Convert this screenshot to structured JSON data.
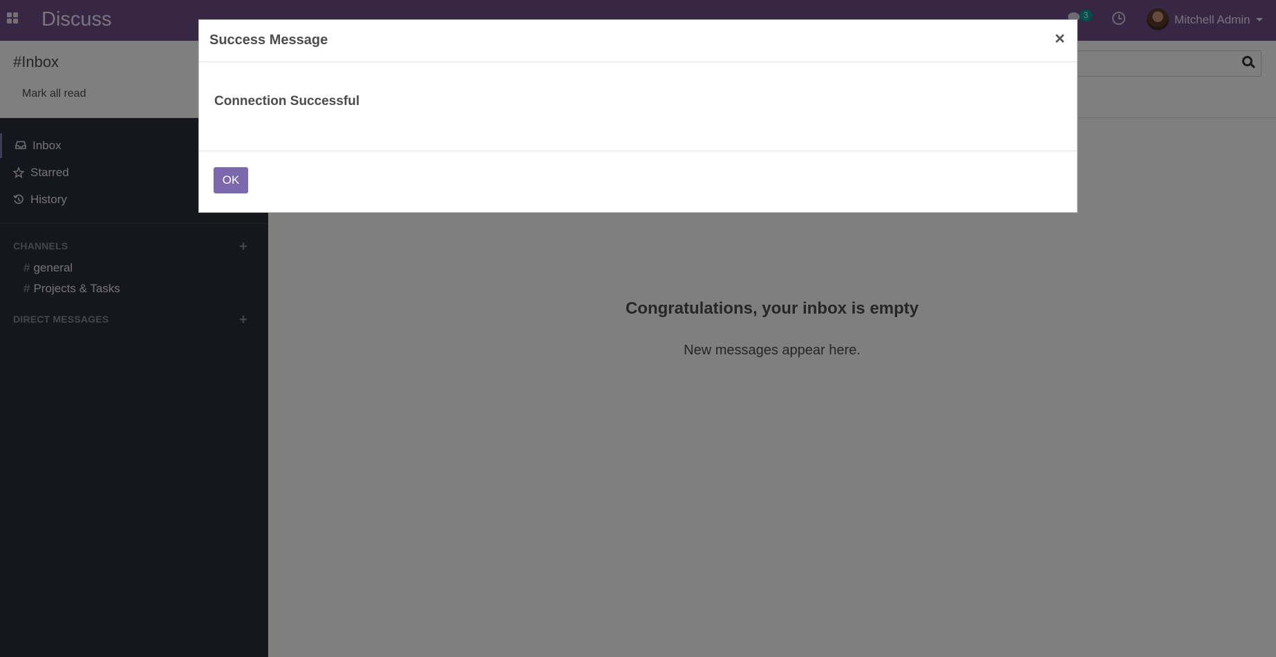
{
  "navbar": {
    "app_name": "Discuss",
    "apps_icon": "grid-icon",
    "chat_badge": "3",
    "chat_icon": "chat-bubble-icon",
    "activity_icon": "clock-icon",
    "user_name": "Mitchell Admin",
    "brand_color": "#6f4f8a"
  },
  "control_panel": {
    "breadcrumb": "#Inbox",
    "mark_all_read": "Mark all read"
  },
  "sidebar": {
    "items": [
      {
        "label": "Inbox",
        "icon": "inbox-icon",
        "active": true
      },
      {
        "label": "Starred",
        "icon": "star-icon",
        "active": false
      },
      {
        "label": "History",
        "icon": "history-icon",
        "active": false
      }
    ],
    "channels_header": "CHANNELS",
    "channels": [
      {
        "hash": "#",
        "name": "general"
      },
      {
        "hash": "#",
        "name": "Projects & Tasks"
      }
    ],
    "dm_header": "DIRECT MESSAGES"
  },
  "main": {
    "empty_title": "Congratulations, your inbox is empty",
    "empty_subtitle": "New messages appear here."
  },
  "modal": {
    "title": "Success Message",
    "close": "×",
    "message": "Connection Successful",
    "ok_label": "OK",
    "ok_color": "#7c68ad"
  }
}
